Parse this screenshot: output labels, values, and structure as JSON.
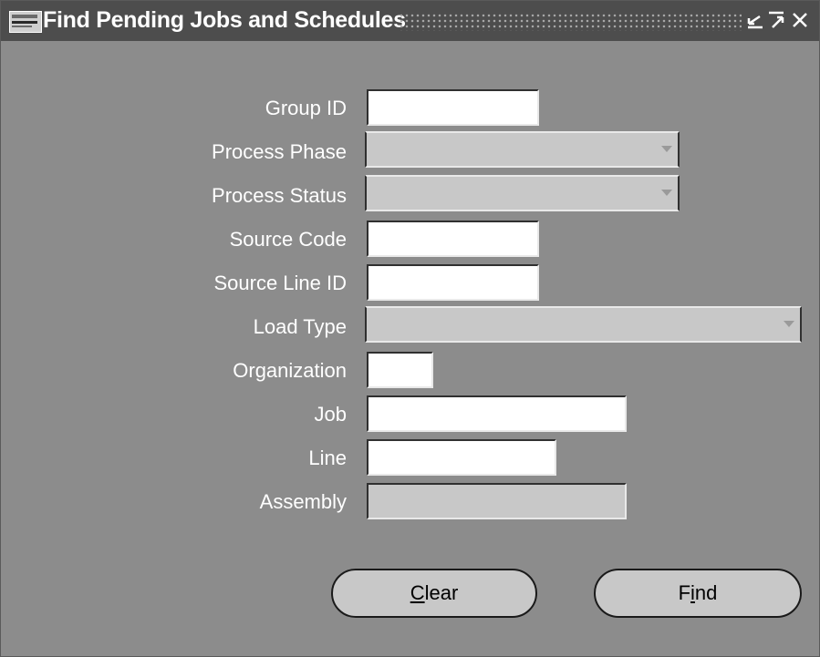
{
  "window": {
    "title": "Find Pending Jobs and Schedules",
    "logo_icon": "oracle-logo-icon",
    "controls": [
      "minimize-icon",
      "maximize-icon",
      "close-icon"
    ]
  },
  "form": {
    "fields": [
      {
        "label": "Group ID",
        "value": "",
        "type": "text"
      },
      {
        "label": "Process Phase",
        "value": "",
        "type": "select"
      },
      {
        "label": "Process Status",
        "value": "",
        "type": "select"
      },
      {
        "label": "Source Code",
        "value": "",
        "type": "text"
      },
      {
        "label": "Source Line ID",
        "value": "",
        "type": "text"
      },
      {
        "label": "Load Type",
        "value": "",
        "type": "select"
      },
      {
        "label": "Organization",
        "value": "",
        "type": "text"
      },
      {
        "label": "Job",
        "value": "",
        "type": "text"
      },
      {
        "label": "Line",
        "value": "",
        "type": "text"
      },
      {
        "label": "Assembly",
        "value": "",
        "type": "text-disabled"
      }
    ]
  },
  "buttons": {
    "clear_access": "C",
    "clear_rest": "lear",
    "find_pre": "F",
    "find_access": "i",
    "find_rest": "nd"
  },
  "colors": {
    "background": "#8c8c8c",
    "titlebar": "#4d4d4d",
    "field": "#ffffff",
    "disabled": "#c8c8c8"
  }
}
